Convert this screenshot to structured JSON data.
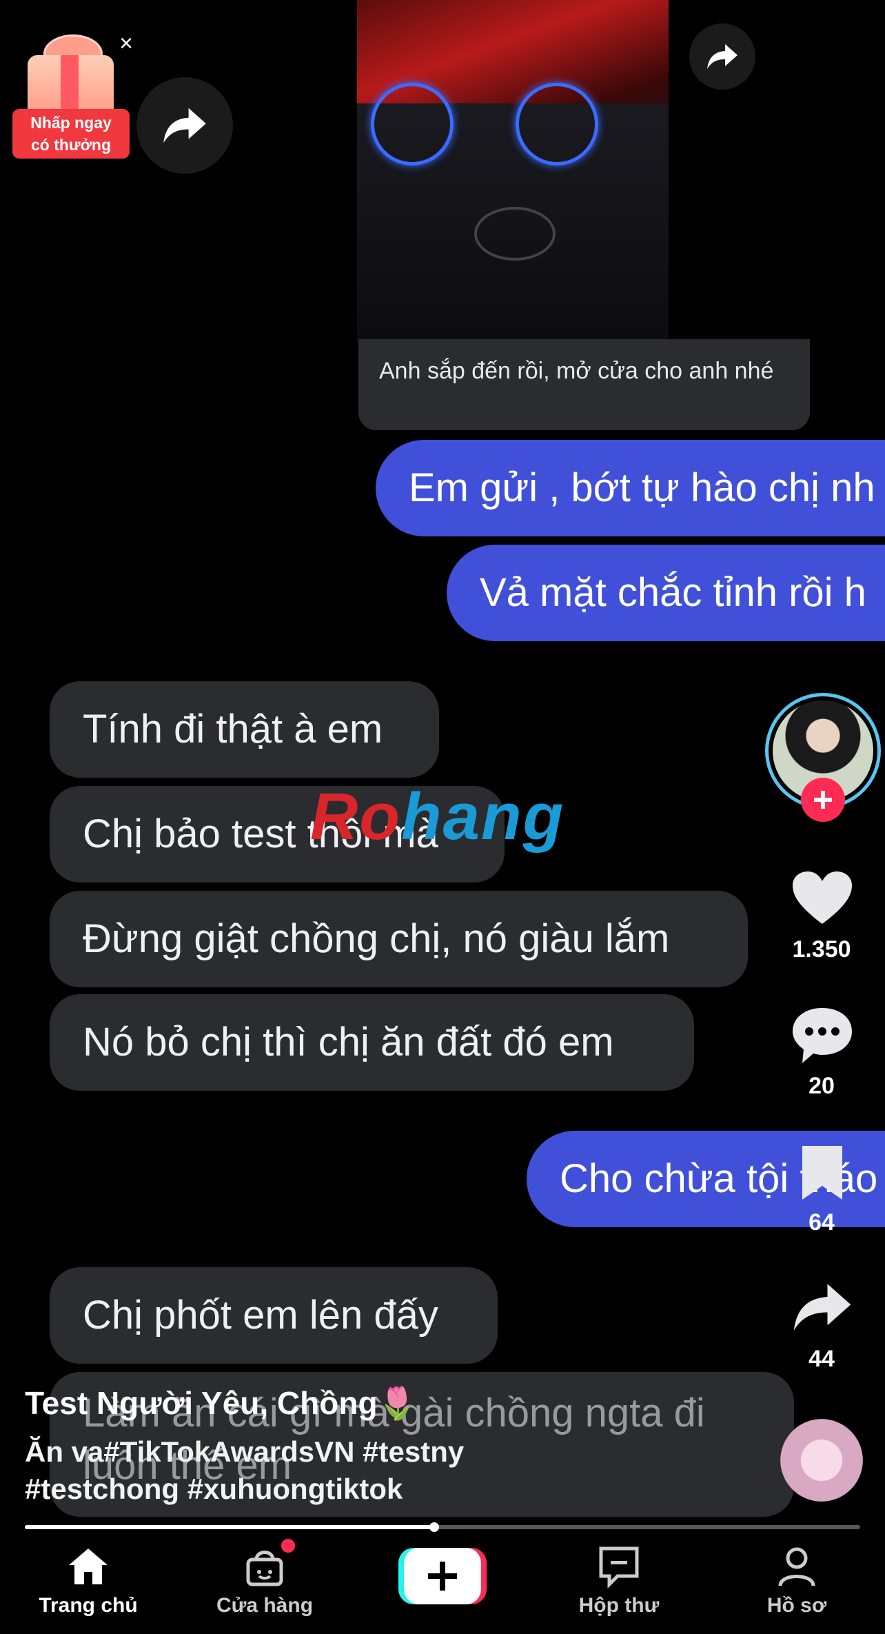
{
  "gift_promo": {
    "label_line1": "Nhấp ngay",
    "label_line2": "có thưởng"
  },
  "video_share_icon": "share-arrow-icon",
  "chat": {
    "received_small": "Anh sắp đến rồi, mở cửa cho anh nhé",
    "messages": [
      {
        "side": "sent",
        "text": "Em gửi , bớt tự hào chị nh"
      },
      {
        "side": "sent",
        "text": "Vả mặt chắc tỉnh rồi h"
      },
      {
        "side": "received",
        "text": "Tính đi thật à em"
      },
      {
        "side": "received",
        "text": "Chị bảo test thôi mà"
      },
      {
        "side": "received",
        "text": "Đừng giật chồng chị, nó giàu lắm"
      },
      {
        "side": "received",
        "text": "Nó bỏ chị thì chị ăn đất đó em"
      },
      {
        "side": "sent",
        "text": "Cho chừa tội tháo"
      },
      {
        "side": "received",
        "text": "Chị phốt em lên đấy"
      },
      {
        "side": "received",
        "text": "Làm ăn cái gì mà gài chồng ngta đi luôn thế em"
      }
    ]
  },
  "watermark": {
    "part1": "Ro",
    "part2": "hang"
  },
  "rail": {
    "likes": "1.350",
    "comments": "20",
    "saves": "64",
    "shares": "44"
  },
  "caption": {
    "title": "Test Người Yêu, Chồng",
    "title_emoji": "🌷",
    "line1": "Ăn va#TikTokAwardsVN #testny",
    "line2": "#testchong #xuhuongtiktok"
  },
  "progress": {
    "fraction": 0.49
  },
  "nav": {
    "home": "Trang chủ",
    "shop": "Cửa hàng",
    "inbox": "Hộp thư",
    "profile": "Hồ sơ"
  },
  "colors": {
    "accent": "#fe2c55",
    "bubble_blue": "#4050d8",
    "bubble_grey": "#2b2c30"
  }
}
